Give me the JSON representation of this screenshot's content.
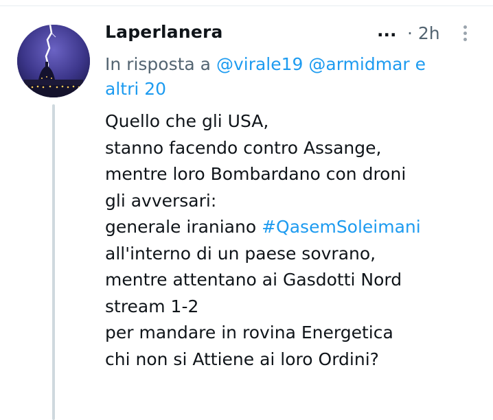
{
  "tweet": {
    "author": {
      "name": "Laperlanera",
      "avatar_icon": "avatar-lightning-dome-icon"
    },
    "ellipsis": "...",
    "time": "· 2h",
    "reply": {
      "prefix": "In risposta a",
      "mentions": [
        "@virale19",
        "@armidmar"
      ],
      "connector": "e",
      "others": "altri 20"
    },
    "text_lines": [
      "Quello che gli USA,",
      "stanno facendo contro Assange,",
      "mentre loro Bombardano con droni",
      "gli avversari:",
      "generale iraniano",
      "all'interno di un paese sovrano,",
      "mentre attentano ai Gasdotti Nord",
      "stream 1-2",
      "per mandare in rovina Energetica",
      "chi non si Attiene ai loro Ordini?"
    ],
    "hashtag": "#QasemSoleimani"
  },
  "colors": {
    "link": "#1d9bf0",
    "secondary_text": "#536471",
    "primary_text": "#0f1419",
    "thread_line": "#cfd9de"
  }
}
